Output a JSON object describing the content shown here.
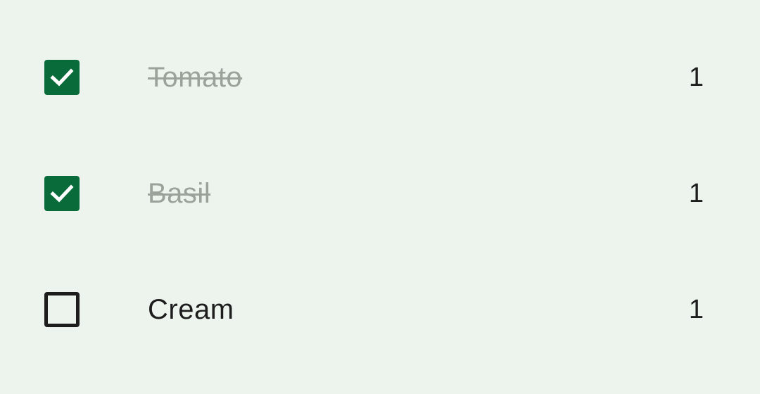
{
  "colors": {
    "background": "#edf4ed",
    "checkbox_checked": "#0a6b3a",
    "text": "#1d1d1d",
    "text_done": "#9aa29a"
  },
  "items": [
    {
      "name": "Tomato",
      "quantity": "1",
      "checked": true
    },
    {
      "name": "Basil",
      "quantity": "1",
      "checked": true
    },
    {
      "name": "Cream",
      "quantity": "1",
      "checked": false
    }
  ],
  "icons": {
    "checked": "checkbox-checked-icon",
    "unchecked": "checkbox-unchecked-icon"
  }
}
